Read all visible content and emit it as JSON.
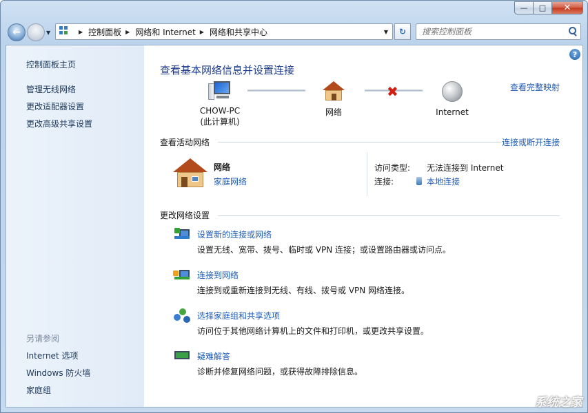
{
  "window": {
    "minimize_glyph": "—",
    "maximize_glyph": "□",
    "close_glyph": "✕"
  },
  "nav": {
    "back_glyph": "←",
    "forward_glyph": "→",
    "dropdown_glyph": "▼",
    "breadcrumbs": [
      "控制面板",
      "网络和 Internet",
      "网络和共享中心"
    ],
    "refresh_glyph": "↻",
    "search_placeholder": "搜索控制面板"
  },
  "sidebar": {
    "home": "控制面板主页",
    "tasks": [
      "管理无线网络",
      "更改适配器设置",
      "更改高级共享设置"
    ],
    "see_also_heading": "另请参阅",
    "see_also": [
      "Internet 选项",
      "Windows 防火墙",
      "家庭组"
    ]
  },
  "help_glyph": "?",
  "main": {
    "title": "查看基本网络信息并设置连接",
    "full_map_link": "查看完整映射",
    "map": {
      "computer_name": "CHOW-PC",
      "computer_sub": "(此计算机)",
      "network": "网络",
      "internet": "Internet",
      "broken_glyph": "✖"
    },
    "active": {
      "heading": "查看活动网络",
      "connect_link": "连接或断开连接",
      "network_name": "网络",
      "network_type_link": "家庭网络",
      "access_type_label": "访问类型:",
      "access_type_value": "无法连接到 Internet",
      "connections_label": "连接:",
      "connection_link": "本地连接"
    },
    "change": {
      "heading": "更改网络设置",
      "tasks": [
        {
          "title": "设置新的连接或网络",
          "desc": "设置无线、宽带、拨号、临时或 VPN 连接；或设置路由器或访问点。"
        },
        {
          "title": "连接到网络",
          "desc": "连接到或重新连接到无线、有线、拨号或 VPN 网络连接。"
        },
        {
          "title": "选择家庭组和共享选项",
          "desc": "访问位于其他网络计算机上的文件和打印机，或更改共享设置。"
        },
        {
          "title": "疑难解答",
          "desc": "诊断并修复网络问题，或获得故障排除信息。"
        }
      ]
    }
  },
  "watermark": "系统之家"
}
